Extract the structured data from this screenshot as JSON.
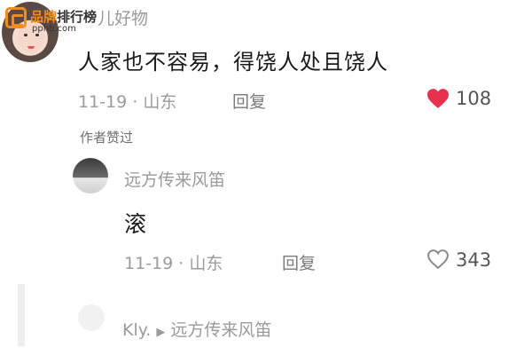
{
  "watermark": {
    "name_orange": "品牌",
    "name_dark": "排行榜",
    "url": "pphb.com"
  },
  "comment": {
    "username_partial": "儿好物",
    "text": "人家也不容易，得饶人处且饶人",
    "date": "11-19",
    "separator": "·",
    "location": "山东",
    "reply_label": "回复",
    "likes": "108",
    "author_liked": "作者赞过"
  },
  "reply": {
    "username": "远方传来风笛",
    "text": "滚",
    "date": "11-19",
    "separator": "·",
    "location": "山东",
    "reply_label": "回复",
    "likes": "343"
  },
  "nested_reply": {
    "username": "Kly.",
    "arrow": "▶",
    "target": "远方传来风笛"
  },
  "colors": {
    "liked_heart": "#e8304f",
    "meta_gray": "#9b9b9b",
    "logo_orange": "#f28c1e"
  }
}
